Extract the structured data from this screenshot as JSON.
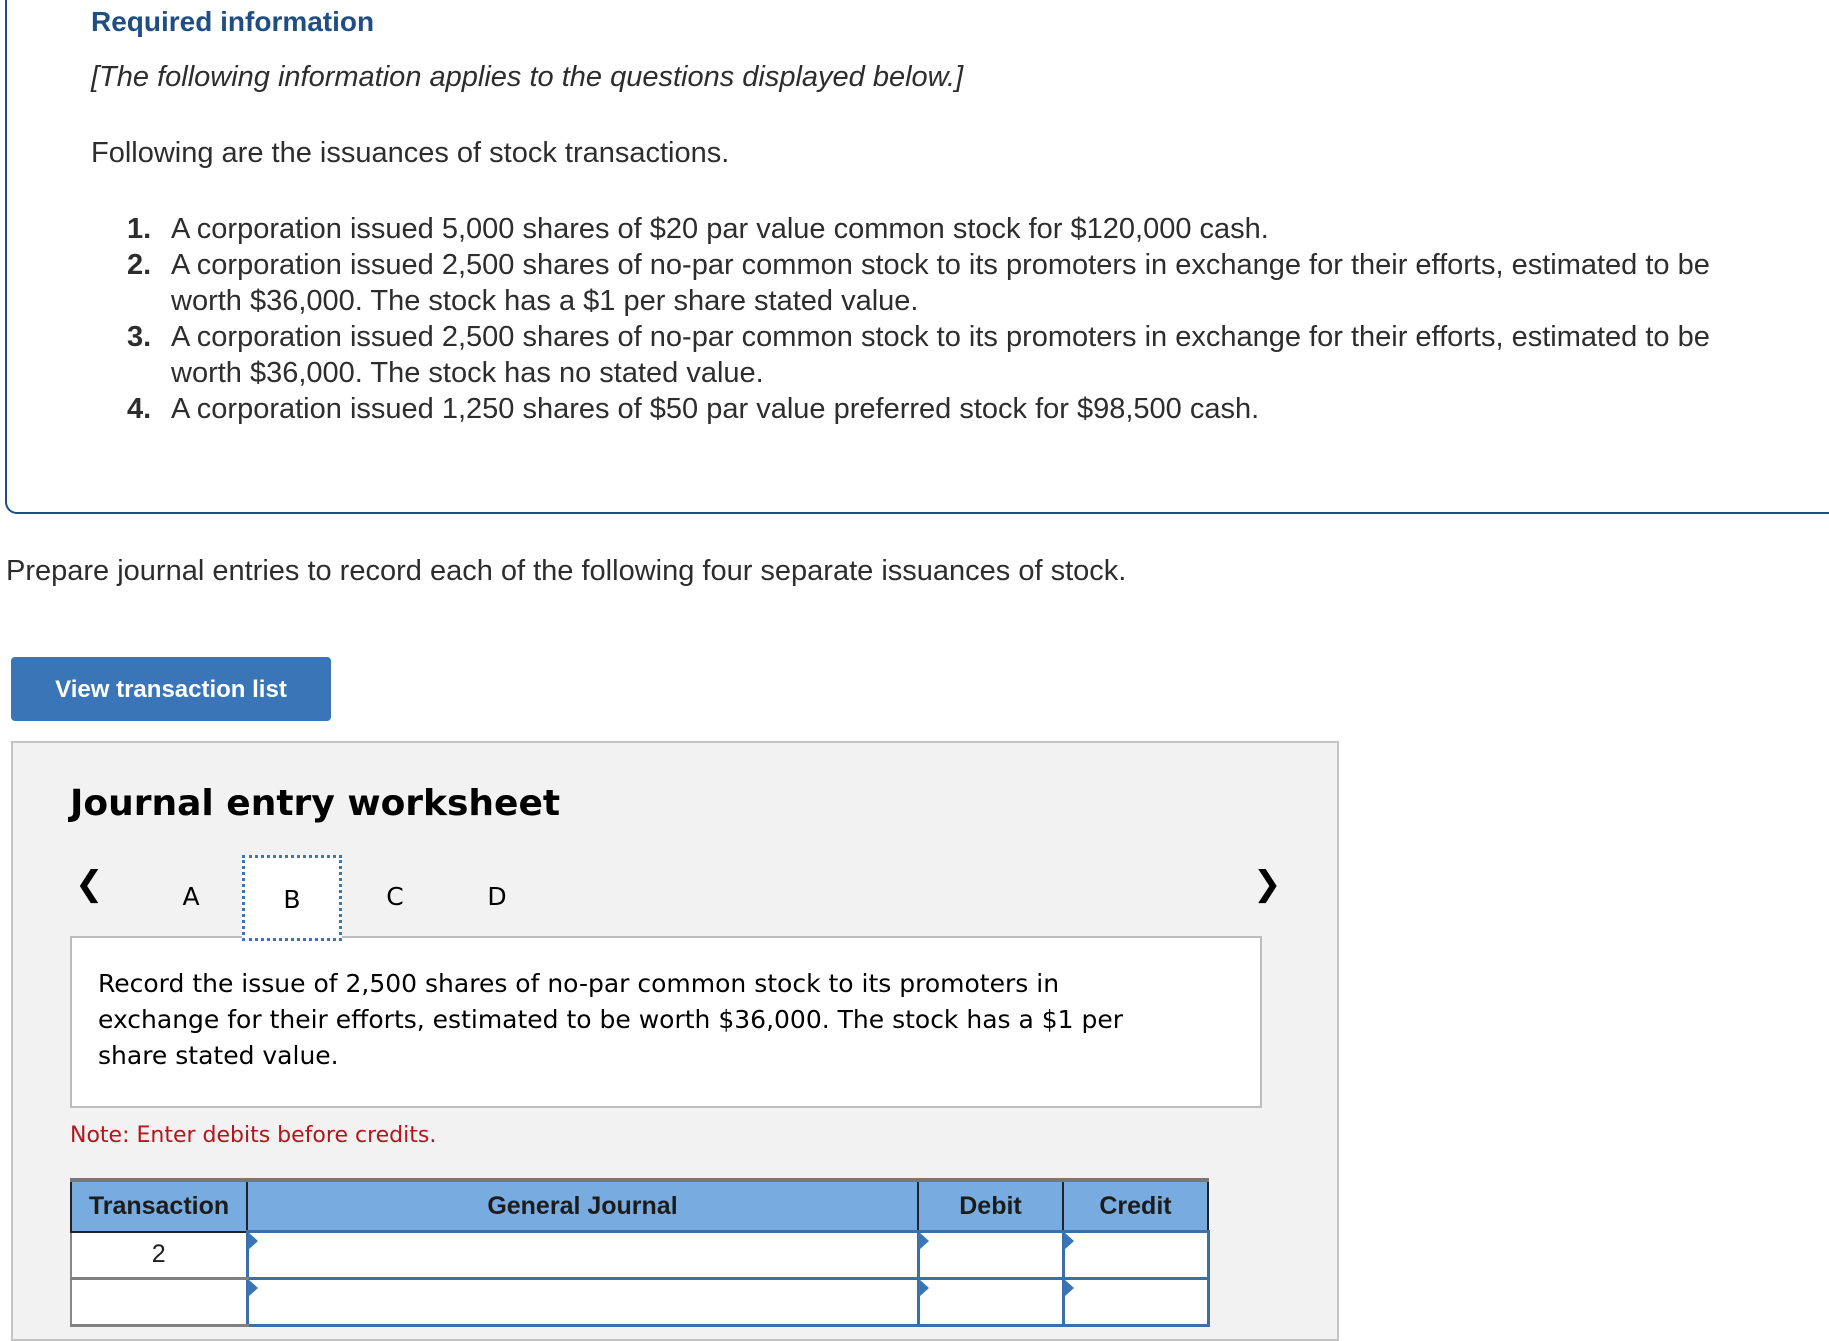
{
  "required_info": {
    "title": "Required information",
    "subtitle": "[The following information applies to the questions displayed below.]",
    "intro": "Following are the issuances of stock transactions.",
    "items": [
      {
        "num": "1.",
        "text": "A corporation issued 5,000 shares of $20 par value common stock for $120,000 cash."
      },
      {
        "num": "2.",
        "text": "A corporation issued 2,500 shares of no-par common stock to its promoters in exchange for their efforts, estimated to be worth $36,000. The stock has a $1 per share stated value."
      },
      {
        "num": "3.",
        "text": "A corporation issued 2,500 shares of no-par common stock to its promoters in exchange for their efforts, estimated to be worth $36,000. The stock has no stated value."
      },
      {
        "num": "4.",
        "text": "A corporation issued 1,250 shares of $50 par value preferred stock for $98,500 cash."
      }
    ]
  },
  "instruction": "Prepare journal entries to record each of the following four separate issuances of stock.",
  "view_button_label": "View transaction list",
  "worksheet": {
    "title": "Journal entry worksheet",
    "prev_icon": "chevron-left-icon",
    "next_icon": "chevron-right-icon",
    "prev_glyph": "❮",
    "next_glyph": "❯",
    "tabs": [
      {
        "label": "A",
        "active": false
      },
      {
        "label": "B",
        "active": true
      },
      {
        "label": "C",
        "active": false
      },
      {
        "label": "D",
        "active": false
      }
    ],
    "description": "Record the issue of 2,500 shares of no-par common stock to its promoters in exchange for their efforts, estimated to be worth $36,000. The stock has a $1 per share stated value.",
    "note": "Note: Enter debits before credits.",
    "table": {
      "headers": [
        "Transaction",
        "General Journal",
        "Debit",
        "Credit"
      ],
      "rows": [
        {
          "transaction": "2",
          "account": "",
          "debit": "",
          "credit": ""
        },
        {
          "transaction": "",
          "account": "",
          "debit": "",
          "credit": ""
        }
      ]
    }
  },
  "colors": {
    "heading_blue": "#1f4e85",
    "button_blue": "#3a76b7",
    "table_header_blue": "#78abe0",
    "note_red": "#b3161b",
    "panel_grey": "#f2f2f2"
  }
}
